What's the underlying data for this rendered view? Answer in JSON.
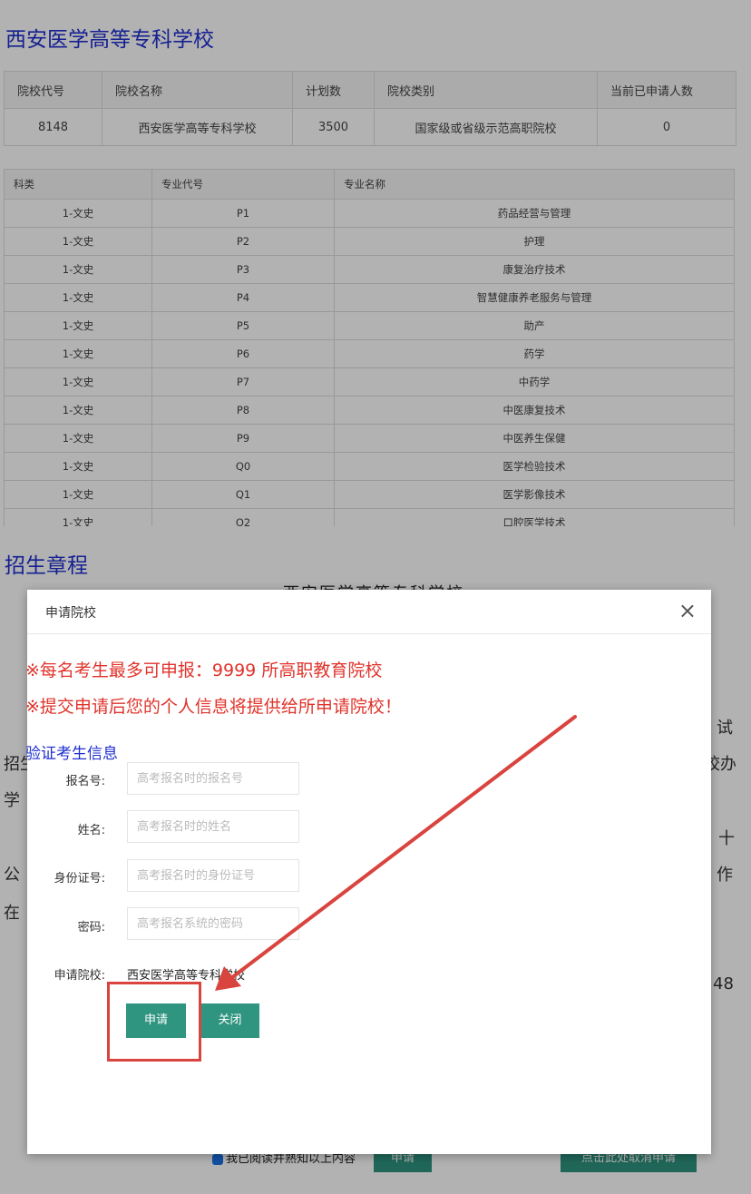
{
  "page": {
    "school_title": "西安医学高等专科学校",
    "school_table": {
      "headers": [
        "院校代号",
        "院校名称",
        "计划数",
        "院校类别",
        "当前已申请人数"
      ],
      "row": [
        "8148",
        "西安医学高等专科学校",
        "3500",
        "国家级或省级示范高职院校",
        "0"
      ]
    },
    "major_table": {
      "headers": [
        "科类",
        "专业代号",
        "专业名称"
      ],
      "rows": [
        [
          "1-文史",
          "P1",
          "药品经营与管理"
        ],
        [
          "1-文史",
          "P2",
          "护理"
        ],
        [
          "1-文史",
          "P3",
          "康复治疗技术"
        ],
        [
          "1-文史",
          "P4",
          "智慧健康养老服务与管理"
        ],
        [
          "1-文史",
          "P5",
          "助产"
        ],
        [
          "1-文史",
          "P6",
          "药学"
        ],
        [
          "1-文史",
          "P7",
          "中药学"
        ],
        [
          "1-文史",
          "P8",
          "中医康复技术"
        ],
        [
          "1-文史",
          "P9",
          "中医养生保健"
        ],
        [
          "1-文史",
          "Q0",
          "医学检验技术"
        ],
        [
          "1-文史",
          "Q1",
          "医学影像技术"
        ],
        [
          "1-文史",
          "Q2",
          "口腔医学技术"
        ]
      ]
    },
    "rules_title": "招生章程",
    "rules_subtitle": "西安医学高等专科学校",
    "bg_fragments": [
      "试",
      "招生",
      "校办",
      "学",
      "十",
      "公",
      "作",
      "在",
      "48"
    ],
    "agree_text": "我已阅读并熟知以上内容",
    "bottom_apply": "申请",
    "bottom_cancel": "点击此处取消申请"
  },
  "modal": {
    "title": "申请院校",
    "close_symbol": "×",
    "warning_1": "※每名考生最多可申报：9999 所高职教育院校",
    "warning_2": "※提交申请后您的个人信息将提供给所申请院校！",
    "verify_title": "验证考生信息",
    "fields": [
      {
        "label": "报名号:",
        "placeholder": "高考报名时的报名号"
      },
      {
        "label": "姓名:",
        "placeholder": "高考报名时的姓名"
      },
      {
        "label": "身份证号:",
        "placeholder": "高考报名时的身份证号"
      },
      {
        "label": "密码:",
        "placeholder": "高考报名系统的密码"
      }
    ],
    "school_label": "申请院校:",
    "school_value": "西安医学高等专科学校",
    "apply_label": "申请",
    "close_label": "关闭"
  },
  "colors": {
    "title_blue": "#1f2fd0",
    "warning_red": "#e0332b",
    "button_teal": "#2f9480",
    "annotation_red": "#d9443f"
  }
}
